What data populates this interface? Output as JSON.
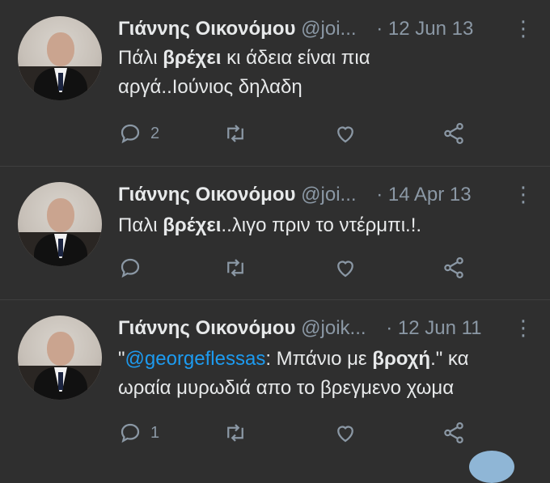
{
  "tweets": [
    {
      "name": "Γιάννης Οικονόμου",
      "handle": "@joi...",
      "date": "· 12 Jun 13",
      "text_parts": [
        "Πάλι ",
        "βρέχει",
        " κι άδεια είναι πια\nαργά..Ιούνιος δηλαδη"
      ],
      "reply_count": "2"
    },
    {
      "name": "Γιάννης Οικονόμου",
      "handle": "@joi...",
      "date": "· 14 Apr 13",
      "text_parts": [
        "Παλι ",
        "βρέχει",
        "..λιγο πριν το ντέρμπι.!."
      ],
      "reply_count": ""
    },
    {
      "name": "Γιάννης Οικονόμου",
      "handle": "@joik...",
      "date": "· 12 Jun 11",
      "text_parts": [
        "\"",
        "@georgeflessas",
        ": Μπάνιο με ",
        "βροχή",
        ".\" κα\nωραία μυρωδιά απο το βρεγμενο χωμα"
      ],
      "reply_count": "1"
    }
  ],
  "more_icon": "⋮",
  "icons": [
    "reply-icon",
    "retweet-icon",
    "like-icon",
    "share-icon",
    "more-icon"
  ]
}
